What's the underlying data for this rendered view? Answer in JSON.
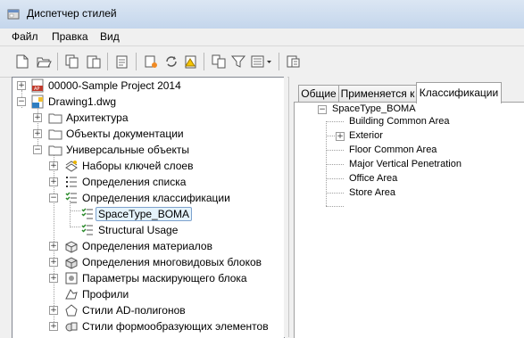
{
  "window": {
    "title": "Диспетчер стилей"
  },
  "menu": {
    "file": "Файл",
    "edit": "Правка",
    "view": "Вид"
  },
  "toolbar": {
    "icons": [
      "new-icon",
      "open-icon",
      "copy-icon",
      "paste-icon",
      "purge-icon",
      "new-style-icon",
      "synchronize-icon",
      "toggle-icon",
      "sort-icon",
      "filter-icon",
      "view-icon",
      "edit-icon"
    ]
  },
  "tree": {
    "project": "00000-Sample Project 2014",
    "drawing": "Drawing1.dwg",
    "architecture": "Архитектура",
    "documentation": "Объекты документации",
    "multipurpose": "Универсальные объекты",
    "layer_keys": "Наборы ключей слоев",
    "list_defs": "Определения списка",
    "class_defs": "Определения классификации",
    "spacetype": "SpaceType_BOMA",
    "structural": "Structural Usage",
    "material_defs": "Определения материалов",
    "multiview_defs": "Определения многовидовых блоков",
    "mask_params": "Параметры маскирующего блока",
    "profiles": "Профили",
    "ad_polygon": "Стили AD-полигонов",
    "mass_elements": "Стили формообразующих элементов"
  },
  "tabs": {
    "general": "Общие",
    "applies_to": "Применяется к",
    "classifications": "Классификации"
  },
  "classifications": {
    "root": "SpaceType_BOMA",
    "items": [
      "Building Common Area",
      "Exterior",
      "Floor Common Area",
      "Major Vertical Penetration",
      "Office Area",
      "Store Area"
    ]
  },
  "colors": {
    "selection_bg": "#e5f3fb",
    "selection_border": "#7da2ce",
    "folder": "#f4d37a"
  }
}
